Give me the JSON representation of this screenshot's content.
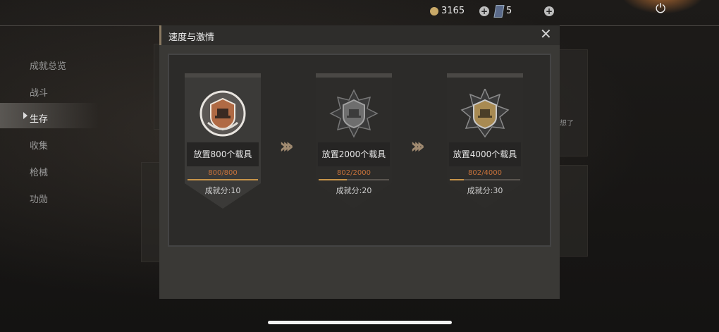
{
  "topbar": {
    "coins": "3165",
    "cards": "5",
    "coin_icon": "gold-coin-icon",
    "card_icon": "card-icon",
    "plus_icon": "plus-icon",
    "power_icon": "power-icon"
  },
  "sidebar": {
    "items": [
      {
        "label": "成就总览"
      },
      {
        "label": "战斗"
      },
      {
        "label": "生存"
      },
      {
        "label": "收集"
      },
      {
        "label": "枪械"
      },
      {
        "label": "功勋"
      }
    ],
    "active_index": 2
  },
  "background_fragment": "想了",
  "modal": {
    "title": "速度与激情",
    "close_icon": "close-icon",
    "tiers": [
      {
        "task": "放置800个载具",
        "progress": "800/800",
        "score": "成就分:10",
        "fill": 1.0,
        "tier": "bronze",
        "done": true
      },
      {
        "task": "放置2000个载具",
        "progress": "802/2000",
        "score": "成就分:20",
        "fill": 0.401,
        "tier": "silver",
        "done": false
      },
      {
        "task": "放置4000个载具",
        "progress": "802/4000",
        "score": "成就分:30",
        "fill": 0.2005,
        "tier": "gold",
        "done": false
      }
    ]
  },
  "colors": {
    "bronze": "#b06a44",
    "silver": "#8a8a8a",
    "gold": "#a88a52",
    "progress": "#c8723a"
  }
}
